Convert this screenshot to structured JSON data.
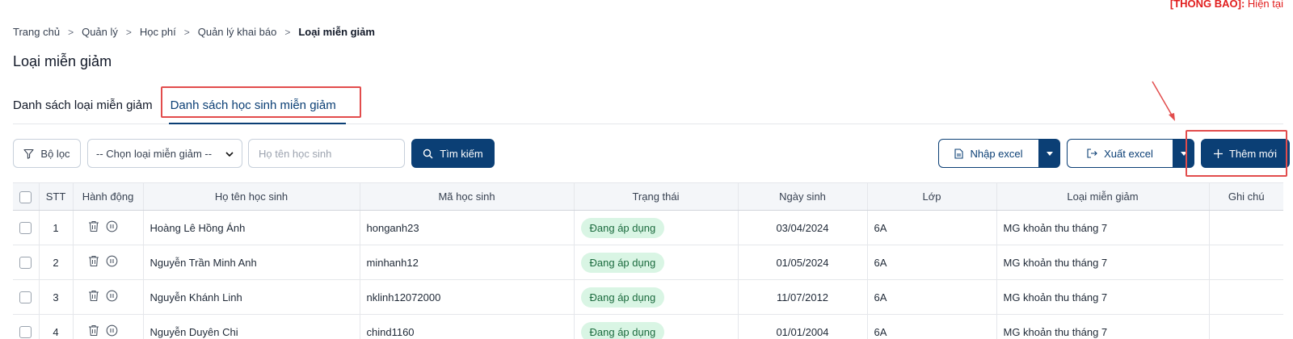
{
  "notice": {
    "label": "[THÔNG BÁO]:",
    "text": "Hiện tại"
  },
  "breadcrumb": {
    "items": [
      "Trang chủ",
      "Quản lý",
      "Học phí",
      "Quản lý khai báo"
    ],
    "current": "Loại miễn giảm"
  },
  "page_title": "Loại miễn giảm",
  "tabs": [
    {
      "label": "Danh sách loại miễn giảm"
    },
    {
      "label": "Danh sách học sinh miễn giảm"
    }
  ],
  "toolbar": {
    "filter_label": "Bộ lọc",
    "select_value": "-- Chọn loại miễn giảm --",
    "search_placeholder": "Họ tên học sinh",
    "search_label": "Tìm kiếm",
    "import_label": "Nhập excel",
    "export_label": "Xuất excel",
    "add_label": "Thêm mới"
  },
  "table": {
    "headers": [
      "STT",
      "Hành động",
      "Họ tên học sinh",
      "Mã học sinh",
      "Trạng thái",
      "Ngày sinh",
      "Lớp",
      "Loại miễn giảm",
      "Ghi chú"
    ],
    "rows": [
      {
        "stt": "1",
        "name": "Hoàng Lê Hồng Ánh",
        "code": "honganh23",
        "status": "Đang áp dụng",
        "dob": "03/04/2024",
        "class": "6A",
        "type": "MG khoản thu tháng 7",
        "note": ""
      },
      {
        "stt": "2",
        "name": "Nguyễn Trần Minh Anh",
        "code": "minhanh12",
        "status": "Đang áp dụng",
        "dob": "01/05/2024",
        "class": "6A",
        "type": "MG khoản thu tháng 7",
        "note": ""
      },
      {
        "stt": "3",
        "name": "Nguyễn Khánh Linh",
        "code": "nklinh12072000",
        "status": "Đang áp dụng",
        "dob": "11/07/2012",
        "class": "6A",
        "type": "MG khoản thu tháng 7",
        "note": ""
      },
      {
        "stt": "4",
        "name": "Nguyễn Duyên Chi",
        "code": "chind1160",
        "status": "Đang áp dụng",
        "dob": "01/01/2004",
        "class": "6A",
        "type": "MG khoản thu tháng 7",
        "note": ""
      }
    ]
  },
  "colors": {
    "primary": "#0b3f75",
    "highlight": "#e24c4c",
    "badge_bg": "#d9f5e4",
    "badge_text": "#1b6b3e"
  }
}
